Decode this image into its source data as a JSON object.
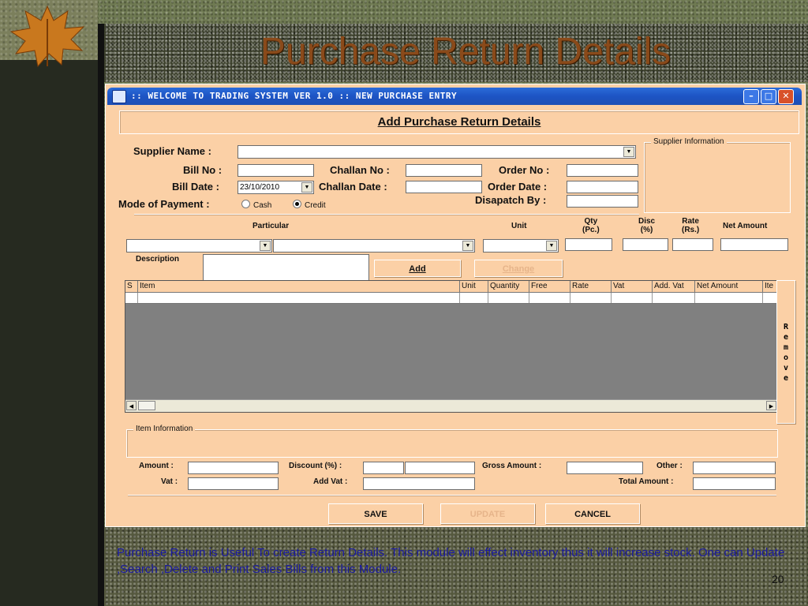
{
  "slide": {
    "title": "Purchase Return Details",
    "description": "Purchase Return is Useful To create Return Details. This module will effect inventory thus it will increase stock. One can Update ,Search ,Delete and Print  Sales Bills from this Module.",
    "page_number": "20"
  },
  "window": {
    "caption": ":: WELCOME TO TRADING SYSTEM VER 1.0 :: NEW PURCHASE ENTRY",
    "heading": "Add Purchase Return Details"
  },
  "form": {
    "supplier_name_label": "Supplier Name :",
    "supplier_name_value": "",
    "bill_no_label": "Bill No :",
    "bill_date_label": "Bill Date :",
    "bill_date_value": "23/10/2010",
    "challan_no_label": "Challan No :",
    "challan_date_label": "Challan Date :",
    "order_no_label": "Order No :",
    "order_date_label": "Order Date :",
    "dispatch_label": "Disapatch By :",
    "mode_label": "Mode of Payment :",
    "cash_label": "Cash",
    "credit_label": "Credit",
    "selected_mode": "Credit",
    "supplier_group_title": "Supplier Information"
  },
  "entry": {
    "particular_label": "Particular",
    "unit_label": "Unit",
    "qty_label_1": "Qty",
    "qty_label_2": "(Pc.)",
    "disc_label_1": "Disc",
    "disc_label_2": "(%)",
    "rate_label_1": "Rate",
    "rate_label_2": "(Rs.)",
    "net_amount_label": "Net Amount",
    "description_label": "Description",
    "add_button": "Add",
    "change_button": "Change"
  },
  "grid": {
    "columns": [
      "S",
      "Item",
      "Unit",
      "Quantity",
      "Free",
      "Rate",
      "Vat",
      "Add. Vat",
      "Net Amount",
      "Ite"
    ],
    "remove_button": "Remove"
  },
  "item_info_group": "Item Information",
  "totals": {
    "amount_label": "Amount :",
    "discount_label": "Discount (%) :",
    "gross_label": "Gross Amount :",
    "other_label": "Other :",
    "vat_label": "Vat :",
    "add_vat_label": "Add Vat :",
    "total_label": "Total Amount :"
  },
  "actions": {
    "save": "SAVE",
    "update": "UPDATE",
    "cancel": "CANCEL"
  },
  "colors": {
    "form_bg": "#fbd0a6",
    "titlebar": "#1d54c4",
    "title_text": "#8a4a1a",
    "caption_text": "#1a1aa0"
  }
}
